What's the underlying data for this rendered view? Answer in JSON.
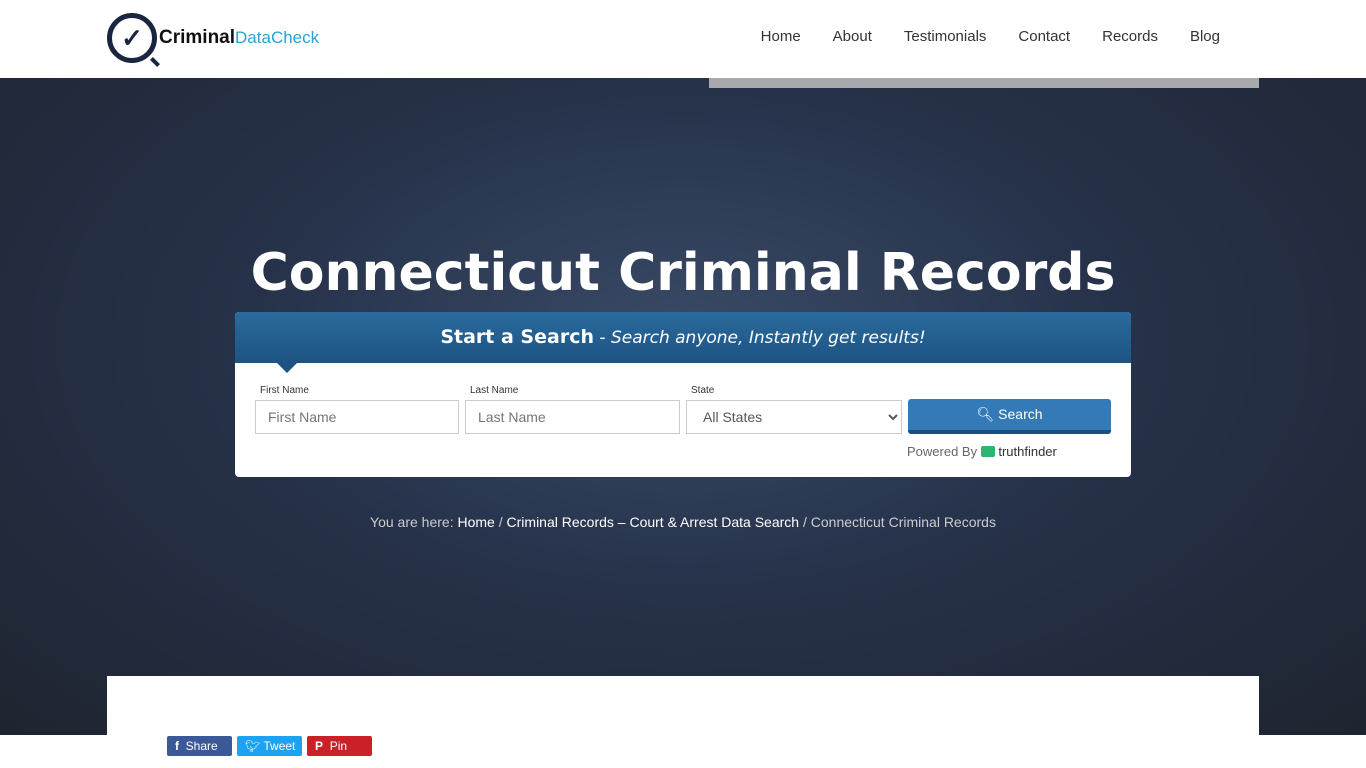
{
  "header": {
    "logo_bold": "Criminal",
    "logo_light": "DataCheck",
    "nav": [
      "Home",
      "About",
      "Testimonials",
      "Contact",
      "Records",
      "Blog"
    ]
  },
  "hero": {
    "title": "Connecticut Criminal Records"
  },
  "search": {
    "heading": "Start a Search",
    "tagline": " - Search anyone, Instantly get results!",
    "first_label": "First Name",
    "first_placeholder": "First Name",
    "last_label": "Last Name",
    "last_placeholder": "Last Name",
    "state_label": "State",
    "state_value": "All States",
    "button": "Search",
    "powered": "Powered By ",
    "brand": "truthfinder"
  },
  "breadcrumb": {
    "prefix": "You are here: ",
    "home": "Home",
    "sep": " / ",
    "parent": "Criminal Records – Court & Arrest Data Search",
    "current": "Connecticut Criminal Records"
  },
  "share": {
    "facebook": "Share",
    "twitter": "Tweet",
    "pinterest": "Pin",
    "colors": {
      "facebook": "#3b5998",
      "twitter": "#1da1f2",
      "pinterest": "#cb2027"
    }
  }
}
